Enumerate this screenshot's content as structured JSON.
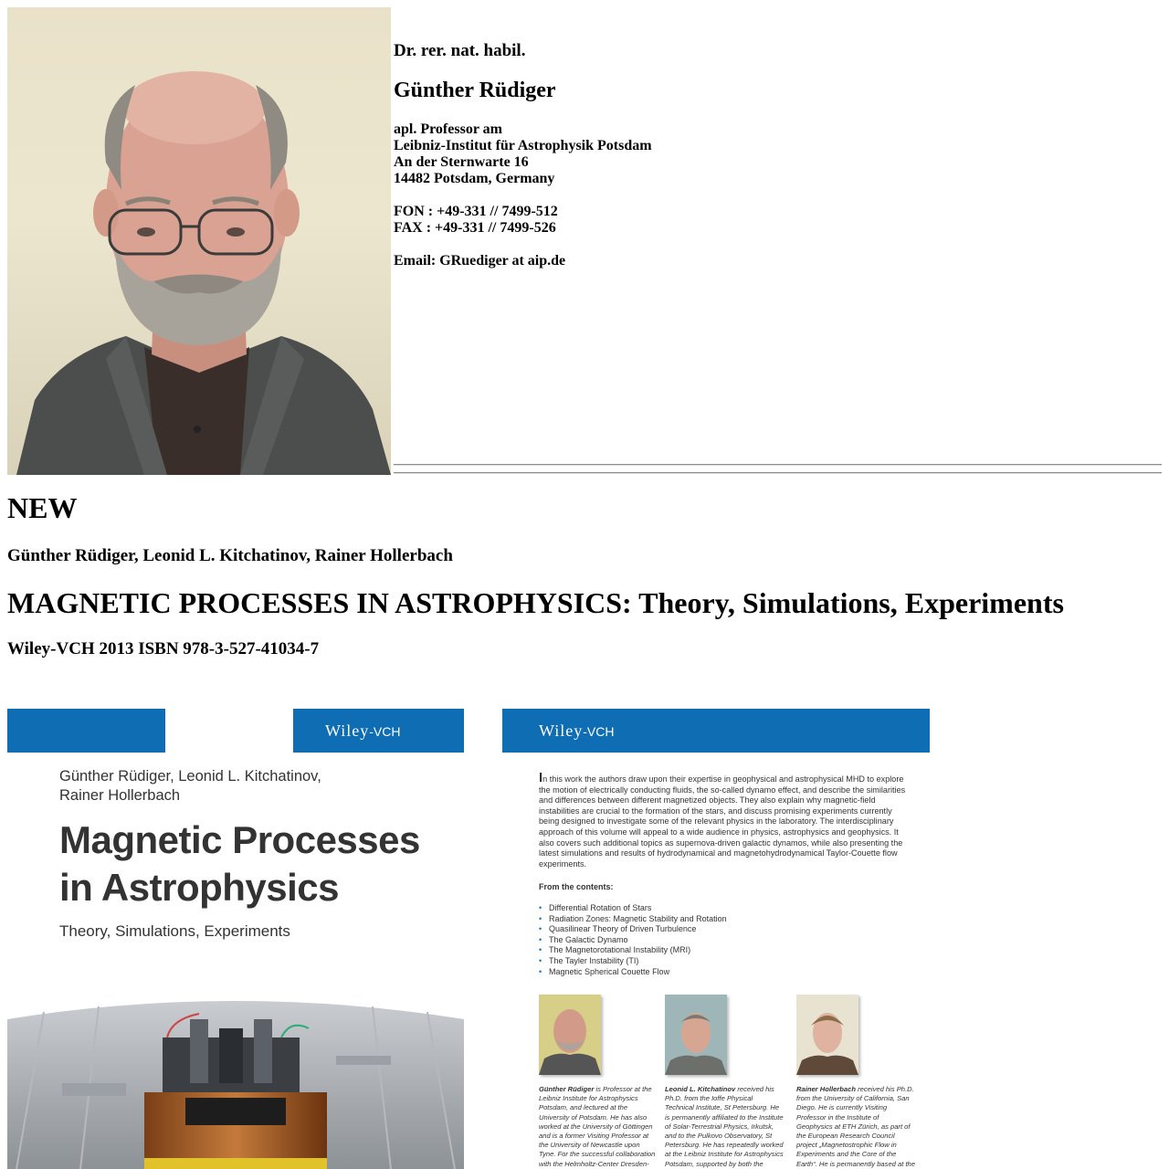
{
  "contact": {
    "degree": "Dr. rer. nat. habil.",
    "name": "Günther Rüdiger",
    "lines": [
      "apl. Professor am",
      "Leibniz-Institut für Astrophysik Potsdam",
      "An der Sternwarte 16",
      "14482 Potsdam, Germany",
      "",
      "FON : +49-331 // 7499-512",
      "FAX : +49-331 // 7499-526",
      "",
      "Email: GRuediger at aip.de"
    ]
  },
  "new_section": {
    "heading": "NEW",
    "authors": "Günther Rüdiger, Leonid L. Kitchatinov, Rainer Hollerbach",
    "title": "MAGNETIC PROCESSES IN ASTROPHYSICS: Theory, Simulations, Experiments",
    "publisher_line": "Wiley-VCH 2013 ISBN 978-3-527-41034-7"
  },
  "front_cover": {
    "publisher_word": "Wiley",
    "publisher_suffix": "-VCH",
    "authors_line1": "Günther Rüdiger, Leonid L. Kitchatinov,",
    "authors_line2": "Rainer Hollerbach",
    "title_line1": "Magnetic Processes",
    "title_line2": "in Astrophysics",
    "subtitle": "Theory, Simulations, Experiments"
  },
  "back_cover": {
    "publisher_word": "Wiley",
    "publisher_suffix": "-VCH",
    "intro_dropcap": "I",
    "intro_text": "n this work the authors draw upon their expertise in geophysical and astrophysical MHD to explore the motion of electrically conducting fluids, the so-called dynamo effect, and describe the similarities and differences between different magnetized objects. They also explain why magnetic-field instabilities are crucial to the formation of the stars, and discuss promising experiments currently being designed to investigate some of the relevant physics in the laboratory. The interdisciplinary approach of this volume will appeal to a wide audience in physics, astrophysics and geophysics. It also covers such additional topics as supernova-driven galactic dynamos, while also presenting the latest simulations and results of hydrodynamical and magnetohydrodynamical Taylor-Couette flow experiments.",
    "contents_heading": "From the contents:",
    "contents": [
      "Differential Rotation of Stars",
      "Radiation Zones: Magnetic Stability and Rotation",
      "Quasilinear Theory of Driven Turbulence",
      "The Galactic Dynamo",
      "The Magnetorotational Instability (MRI)",
      "The Tayler Instability (TI)",
      "Magnetic Spherical Couette Flow"
    ],
    "bios": [
      {
        "name": "Günther Rüdiger",
        "text": " is Professor at the Leibniz Institute for Astrophysics Potsdam, and lectured at the University of Potsdam. He has also worked at the University of Göttingen and is a former Visiting Professor at the University of Newcastle upon Tyne. For the successful collaboration with the Helmholtz-Center Dresden-Rossendorf regarding the"
      },
      {
        "name": "Leonid L. Kitchatinov",
        "text": " received his Ph.D. from the Ioffe Physical Technical Institute, St Petersburg. He is permanently affiliated to the Institute of Solar-Terrestrial Physics, Irkutsk, and to the Pulkovo Observatory, St Petersburg. He has repeatedly worked at the Leibniz Institute for Astrophysics Potsdam, supported by both the Deutsche Forschungsgemein-"
      },
      {
        "name": "Rainer Hollerbach",
        "text": " received his Ph.D. from the University of California, San Diego. He is currently Visiting Professor in the Institute of Geophysics at ETH Zürich, as part of the European Research Council project „Magnetostrophic Flow in Experiments and the Core of the Earth“. He is permanently based at the University of Leeds, England. He is a"
      }
    ]
  },
  "colors": {
    "wiley_blue": "#0f6db4",
    "page_background": "#ffffff"
  }
}
